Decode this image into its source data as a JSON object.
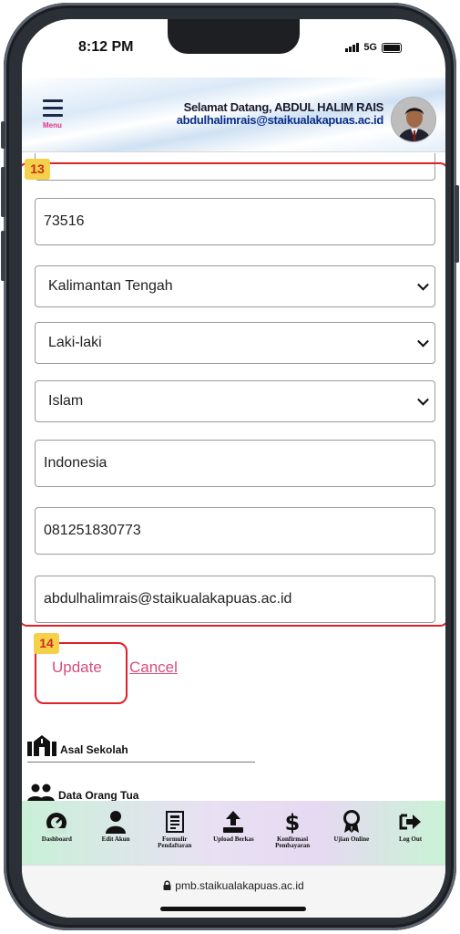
{
  "status_bar": {
    "time": "8:12 PM",
    "network": "5G"
  },
  "header": {
    "menu_label": "Menu",
    "welcome_line": "Selamat Datang, ABDUL HALIM RAIS",
    "email_line": "abdulhalimrais@staikualakapuas.ac.id"
  },
  "annotations": {
    "form_group_number": "13",
    "update_group_number": "14"
  },
  "form": {
    "postal_code": "73516",
    "province": "Kalimantan Tengah",
    "gender": "Laki-laki",
    "religion": "Islam",
    "nationality": "Indonesia",
    "phone": "081251830773",
    "email": "abdulhalimrais@staikualakapuas.ac.id"
  },
  "actions": {
    "update_label": "Update",
    "cancel_label": "Cancel"
  },
  "sections": [
    {
      "label": "Asal Sekolah",
      "icon": "school-icon"
    },
    {
      "label": "Data Orang Tua",
      "icon": "users-icon"
    }
  ],
  "bottom_nav": [
    {
      "label": "Dashboard",
      "icon": "dashboard-icon"
    },
    {
      "label": "Edit Akun",
      "icon": "user-icon"
    },
    {
      "label": "Formulir Pendaftaran",
      "icon": "form-icon"
    },
    {
      "label": "Upload Berkas",
      "icon": "upload-icon"
    },
    {
      "label": "Konfirmasi Pembayaran",
      "icon": "dollar-icon"
    },
    {
      "label": "Ujian Online",
      "icon": "award-icon"
    },
    {
      "label": "Log Out",
      "icon": "logout-icon"
    }
  ],
  "url_bar": {
    "url": "pmb.staikualakapuas.ac.id"
  },
  "colors": {
    "accent_pink": "#d94c7a",
    "annotation_red": "#e0202a",
    "annotation_badge": "#f5d04a"
  }
}
